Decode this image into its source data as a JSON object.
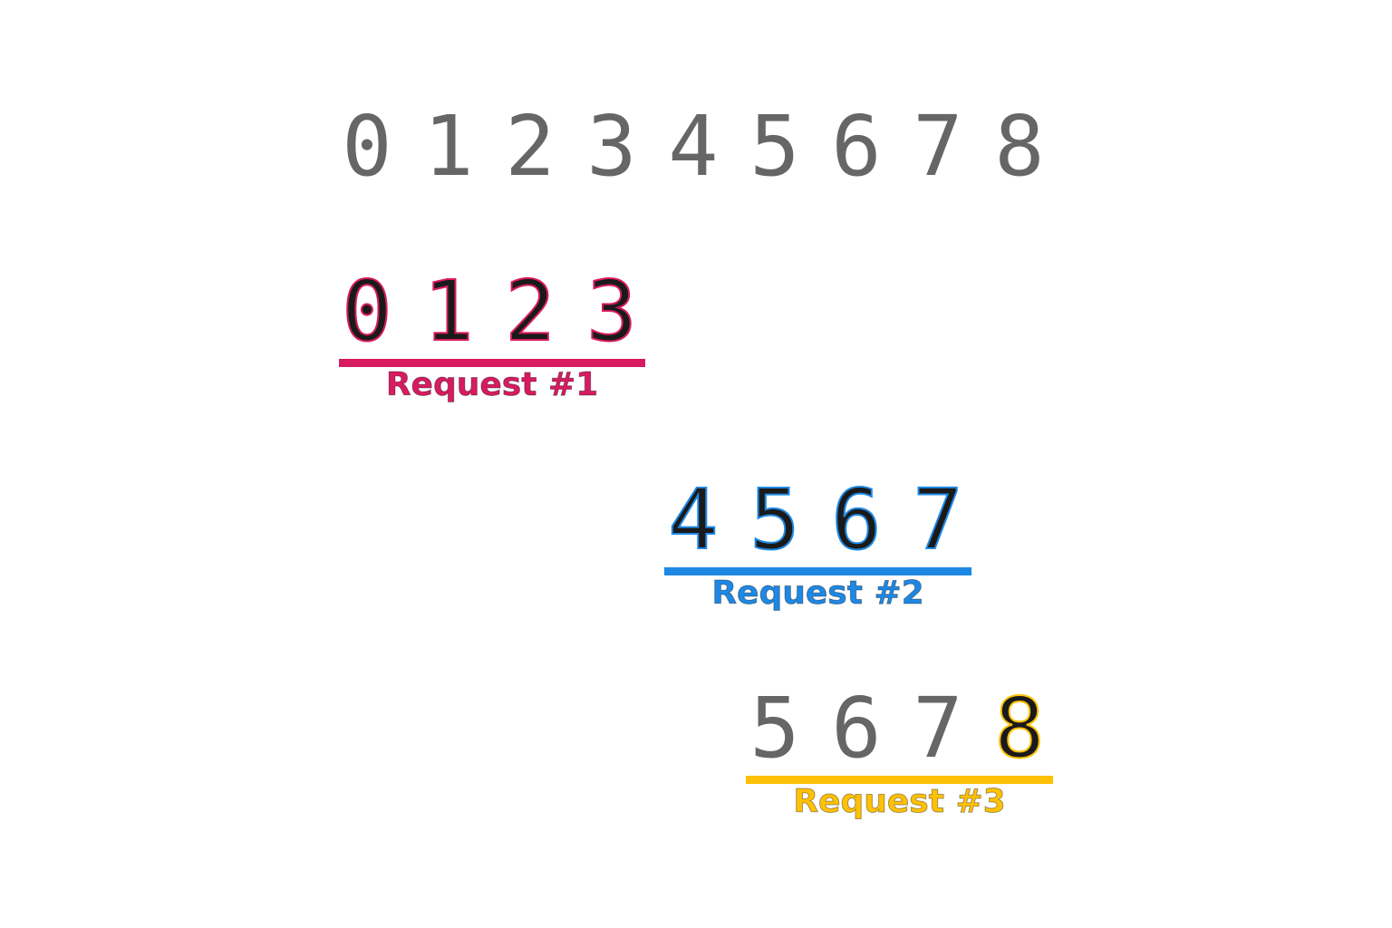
{
  "sequence": [
    "0",
    "1",
    "2",
    "3",
    "4",
    "5",
    "6",
    "7",
    "8"
  ],
  "requests": [
    {
      "label": "Request #1",
      "digits": [
        "0",
        "1",
        "2",
        "3"
      ],
      "highlighted": [
        true,
        true,
        true,
        true
      ],
      "color": "#d81b60"
    },
    {
      "label": "Request #2",
      "digits": [
        "4",
        "5",
        "6",
        "7"
      ],
      "highlighted": [
        true,
        true,
        true,
        true
      ],
      "color": "#1e88e5"
    },
    {
      "label": "Request #3",
      "digits": [
        "5",
        "6",
        "7",
        "8"
      ],
      "highlighted": [
        false,
        false,
        false,
        true
      ],
      "color": "#ffc107"
    }
  ]
}
